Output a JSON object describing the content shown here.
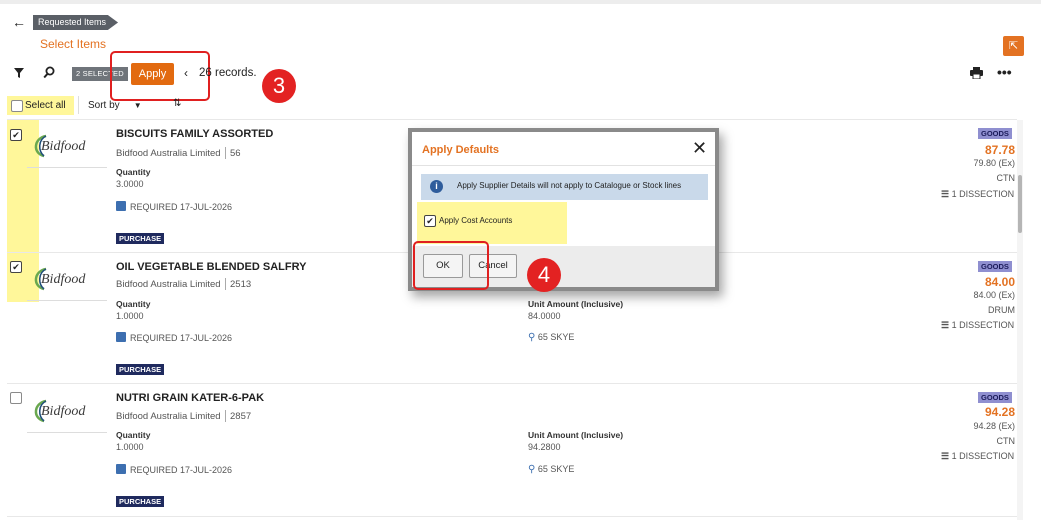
{
  "header": {
    "breadcrumb": "Requested Items",
    "page_title": "Select Items"
  },
  "toolbar": {
    "selected_badge": "2 SELECTED",
    "apply_label": "Apply",
    "records": "26 records.",
    "select_all": "Select all",
    "sort_by": "Sort by"
  },
  "annotations": {
    "step3": "3",
    "step4": "4"
  },
  "items": [
    {
      "title": "BISCUITS FAMILY ASSORTED",
      "supplier": "Bidfood Australia Limited",
      "supplier_code": "56",
      "qty_label": "Quantity",
      "qty": "3.0000",
      "required": "REQUIRED 17-JUL-2026",
      "tag": "PURCHASE",
      "type_tag": "GOODS",
      "price": "87.78",
      "price_ex": "79.80 (Ex)",
      "uom": "CTN",
      "dissection": "1 DISSECTION",
      "checked": true,
      "logo": "Bidfood"
    },
    {
      "title": "OIL VEGETABLE BLENDED SALFRY",
      "supplier": "Bidfood Australia Limited",
      "supplier_code": "2513",
      "qty_label": "Quantity",
      "qty": "1.0000",
      "required": "REQUIRED 17-JUL-2026",
      "tag": "PURCHASE",
      "unit_label": "Unit Amount (Inclusive)",
      "unit_amount": "84.0000",
      "location": "65 SKYE",
      "type_tag": "GOODS",
      "price": "84.00",
      "price_ex": "84.00 (Ex)",
      "uom": "DRUM",
      "dissection": "1 DISSECTION",
      "checked": true,
      "logo": "Bidfood"
    },
    {
      "title": "NUTRI GRAIN KATER-6-PAK",
      "supplier": "Bidfood Australia Limited",
      "supplier_code": "2857",
      "qty_label": "Quantity",
      "qty": "1.0000",
      "required": "REQUIRED 17-JUL-2026",
      "tag": "PURCHASE",
      "unit_label": "Unit Amount (Inclusive)",
      "unit_amount": "94.2800",
      "location": "65 SKYE",
      "type_tag": "GOODS",
      "price": "94.28",
      "price_ex": "94.28 (Ex)",
      "uom": "CTN",
      "dissection": "1 DISSECTION",
      "checked": false,
      "logo": "Bidfood"
    }
  ],
  "dialog": {
    "title": "Apply Defaults",
    "info": "Apply Supplier Details will not apply to Catalogue or Stock lines",
    "checkbox_label": "Apply Cost Accounts",
    "ok_label": "OK",
    "cancel_label": "Cancel"
  },
  "colors": {
    "accent": "#e37222",
    "apply_button": "#e26a10",
    "highlight": "#fff79a",
    "annotation": "#e32222",
    "purchase_tag": "#1f2a5e",
    "goods_tag": "#8f8fd0"
  },
  "icons": [
    "back-arrow-icon",
    "filter-icon",
    "search-icon",
    "chevron-left-icon",
    "print-icon",
    "more-icon",
    "sort-order-icon",
    "expand-icon",
    "calendar-icon",
    "location-pin-icon",
    "dissection-icon",
    "info-icon",
    "close-icon"
  ]
}
